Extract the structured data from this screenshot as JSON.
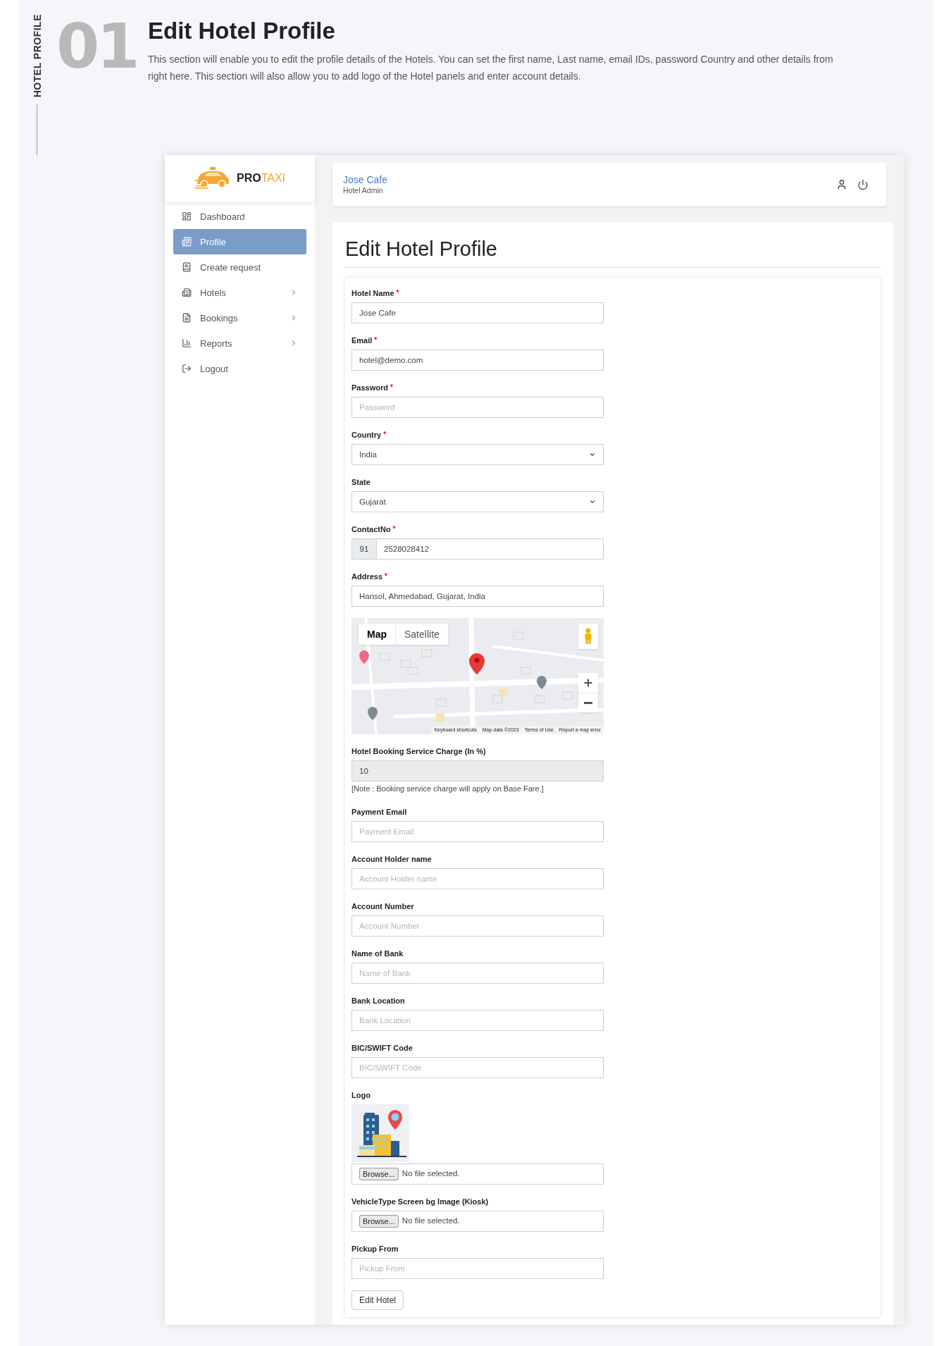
{
  "section": {
    "label": "HOTEL PROFILE",
    "number": "01",
    "title": "Edit Hotel Profile",
    "description": "This section will enable you to edit the profile details of the Hotels. You can set the first name, Last name, email IDs, password Country and other details from right here. This section will also allow you to add logo of the Hotel panels and enter account details."
  },
  "sidebar": {
    "brand": {
      "part_1": "PRO",
      "part_2": "TAXI"
    },
    "items": [
      {
        "label": "Dashboard",
        "selected": false,
        "has_submenu": false
      },
      {
        "label": "Profile",
        "selected": true,
        "has_submenu": false
      },
      {
        "label": "Create request",
        "selected": false,
        "has_submenu": false
      },
      {
        "label": "Hotels",
        "selected": false,
        "has_submenu": true
      },
      {
        "label": "Bookings",
        "selected": false,
        "has_submenu": true
      },
      {
        "label": "Reports",
        "selected": false,
        "has_submenu": true
      },
      {
        "label": "Logout",
        "selected": false,
        "has_submenu": false
      }
    ]
  },
  "header": {
    "name": "Jose Cafe",
    "role": "Hotel Admin"
  },
  "page_title": "Edit Hotel Profile",
  "form": {
    "fields": [
      {
        "kind": "text",
        "label": "Hotel Name",
        "required_mark": "*",
        "value": "Jose Cafe"
      },
      {
        "kind": "text",
        "label": "Email",
        "required_mark": "*",
        "value": "hotel@demo.com"
      },
      {
        "kind": "text",
        "label": "Password",
        "required_mark": "*",
        "placeholder": "Password"
      },
      {
        "kind": "select",
        "label": "Country",
        "required_mark": "*",
        "value": "India"
      },
      {
        "kind": "select",
        "label": "State",
        "value": "Gujarat"
      },
      {
        "kind": "phone",
        "label": "ContactNo",
        "required_mark": "*",
        "prefix": "91",
        "value": "2528028412"
      },
      {
        "kind": "text",
        "label": "Address",
        "required_mark": "*",
        "value": "Hansol, Ahmedabad, Gujarat, India"
      },
      {
        "kind": "map",
        "map_types": [
          {
            "label": "Map",
            "selected": true
          },
          {
            "label": "Satellite",
            "selected": false
          }
        ],
        "footer": [
          "Keyboard shortcuts",
          "Map data ©2023",
          "Terms of Use",
          "Report a map error"
        ]
      },
      {
        "kind": "readonly",
        "label": "Hotel Booking Service Charge (In %)",
        "value": "10",
        "note": "[Note : Booking service charge will apply on Base Fare.]"
      },
      {
        "kind": "text",
        "label": "Payment Email",
        "placeholder": "Payment Email"
      },
      {
        "kind": "text",
        "label": "Account Holder name",
        "placeholder": "Account Holder name"
      },
      {
        "kind": "text",
        "label": "Account Number",
        "placeholder": "Account Number"
      },
      {
        "kind": "text",
        "label": "Name of Bank",
        "placeholder": "Name of Bank"
      },
      {
        "kind": "text",
        "label": "Bank Location",
        "placeholder": "Bank Location"
      },
      {
        "kind": "text",
        "label": "BIC/SWIFT Code",
        "placeholder": "BIC/SWIFT Code"
      },
      {
        "kind": "file",
        "label": "Logo",
        "has_preview": true,
        "button": "Browse...",
        "status": "No file selected."
      },
      {
        "kind": "file",
        "label": "VehicleType Screen bg Image (Kiosk)",
        "has_preview": false,
        "button": "Browse...",
        "status": "No file selected."
      },
      {
        "kind": "text",
        "label": "Pickup From",
        "placeholder": "Pickup From"
      }
    ],
    "submit": "Edit Hotel"
  }
}
